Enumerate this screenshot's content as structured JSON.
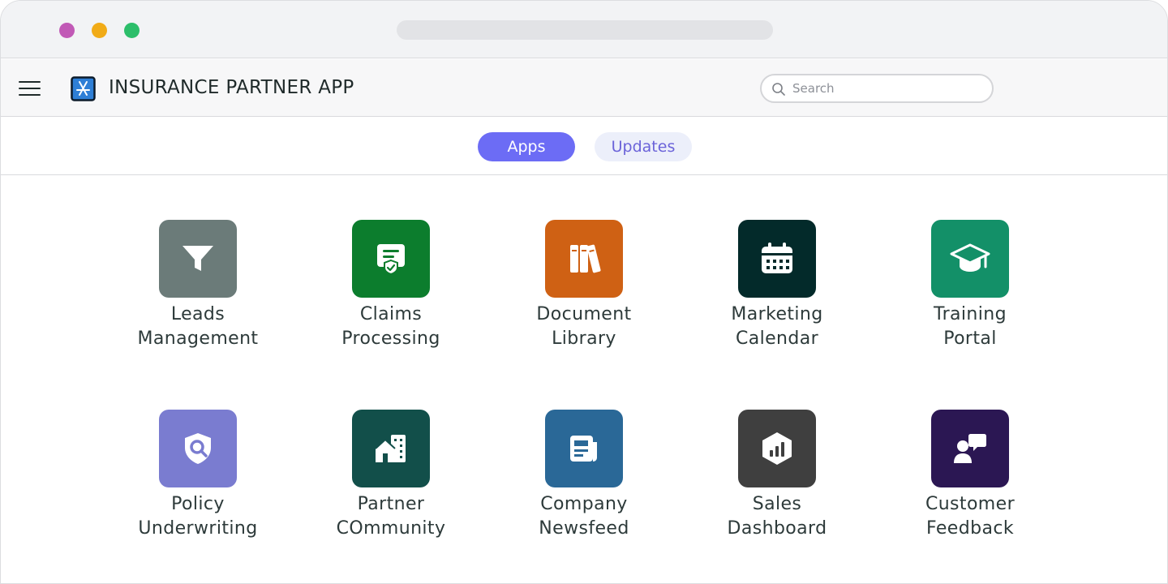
{
  "window": {
    "traffic_lights": [
      "#c159b6",
      "#f1ab17",
      "#2cbe6a"
    ]
  },
  "header": {
    "title": "INSURANCE PARTNER APP",
    "logo_icon": "app-store-icon",
    "menu_icon": "hamburger-menu-icon"
  },
  "search": {
    "placeholder": "Search",
    "value": ""
  },
  "tabs": [
    {
      "label": "Apps",
      "active": true
    },
    {
      "label": "Updates",
      "active": false
    }
  ],
  "apps": [
    {
      "line1": "Leads",
      "line2": "Management",
      "icon": "funnel-icon",
      "color": "#6b7b79"
    },
    {
      "line1": "Claims",
      "line2": "Processing",
      "icon": "certificate-check-icon",
      "color": "#0c7d2d"
    },
    {
      "line1": "Document",
      "line2": "Library",
      "icon": "books-icon",
      "color": "#cf6114"
    },
    {
      "line1": "Marketing",
      "line2": "Calendar",
      "icon": "calendar-icon",
      "color": "#032a2a"
    },
    {
      "line1": "Training",
      "line2": "Portal",
      "icon": "graduation-cap-icon",
      "color": "#139068"
    },
    {
      "line1": "Policy",
      "line2": "Underwriting",
      "icon": "shield-search-icon",
      "color": "#7a7cd0"
    },
    {
      "line1": "Partner",
      "line2": "COmmunity",
      "icon": "buildings-icon",
      "color": "#124f4a"
    },
    {
      "line1": "Company",
      "line2": "Newsfeed",
      "icon": "newspaper-icon",
      "color": "#2a6897"
    },
    {
      "line1": "Sales",
      "line2": "Dashboard",
      "icon": "bar-chart-hexagon-icon",
      "color": "#3f3f3f"
    },
    {
      "line1": "Customer",
      "line2": "Feedback",
      "icon": "user-chat-icon",
      "color": "#2b1753"
    }
  ]
}
